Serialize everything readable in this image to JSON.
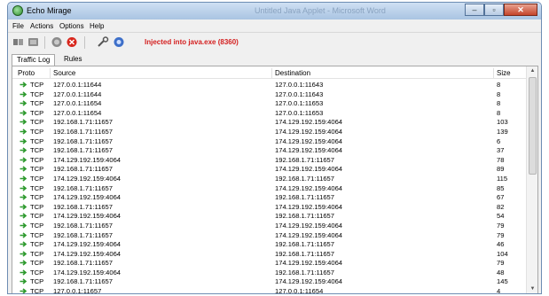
{
  "window": {
    "title": "Echo Mirage",
    "background_title": "Untitled Java Applet - Microsoft Word",
    "controls": [
      "–",
      "▫",
      "✕"
    ]
  },
  "menu": [
    "File",
    "Actions",
    "Options",
    "Help"
  ],
  "toolbar": {
    "status": "Injected into java.exe (8360)"
  },
  "tabs": [
    "Traffic Log",
    "Rules"
  ],
  "table": {
    "columns": [
      "Proto",
      "Source",
      "Destination",
      "Size"
    ],
    "rows": [
      [
        "TCP",
        "127.0.0.1:11644",
        "127.0.0.1:11643",
        "8"
      ],
      [
        "TCP",
        "127.0.0.1:11644",
        "127.0.0.1:11643",
        "8"
      ],
      [
        "TCP",
        "127.0.0.1:11654",
        "127.0.0.1:11653",
        "8"
      ],
      [
        "TCP",
        "127.0.0.1:11654",
        "127.0.0.1:11653",
        "8"
      ],
      [
        "TCP",
        "192.168.1.71:11657",
        "174.129.192.159:4064",
        "103"
      ],
      [
        "TCP",
        "192.168.1.71:11657",
        "174.129.192.159:4064",
        "139"
      ],
      [
        "TCP",
        "192.168.1.71:11657",
        "174.129.192.159:4064",
        "6"
      ],
      [
        "TCP",
        "192.168.1.71:11657",
        "174.129.192.159:4064",
        "37"
      ],
      [
        "TCP",
        "174.129.192.159:4064",
        "192.168.1.71:11657",
        "78"
      ],
      [
        "TCP",
        "192.168.1.71:11657",
        "174.129.192.159:4064",
        "89"
      ],
      [
        "TCP",
        "174.129.192.159:4064",
        "192.168.1.71:11657",
        "115"
      ],
      [
        "TCP",
        "192.168.1.71:11657",
        "174.129.192.159:4064",
        "85"
      ],
      [
        "TCP",
        "174.129.192.159:4064",
        "192.168.1.71:11657",
        "67"
      ],
      [
        "TCP",
        "192.168.1.71:11657",
        "174.129.192.159:4064",
        "82"
      ],
      [
        "TCP",
        "174.129.192.159:4064",
        "192.168.1.71:11657",
        "54"
      ],
      [
        "TCP",
        "192.168.1.71:11657",
        "174.129.192.159:4064",
        "79"
      ],
      [
        "TCP",
        "192.168.1.71:11657",
        "174.129.192.159:4064",
        "79"
      ],
      [
        "TCP",
        "174.129.192.159:4064",
        "192.168.1.71:11657",
        "46"
      ],
      [
        "TCP",
        "174.129.192.159:4064",
        "192.168.1.71:11657",
        "104"
      ],
      [
        "TCP",
        "192.168.1.71:11657",
        "174.129.192.159:4064",
        "79"
      ],
      [
        "TCP",
        "174.129.192.159:4064",
        "192.168.1.71:11657",
        "48"
      ],
      [
        "TCP",
        "192.168.1.71:11657",
        "174.129.192.159:4064",
        "145"
      ],
      [
        "TCP",
        "127.0.0.1:11657",
        "127.0.0.1:11654",
        "4"
      ]
    ]
  },
  "icons": {
    "app": "echo-mirage-icon",
    "row": "green-arrow-icon",
    "toolbar": [
      "stop-icon",
      "record-icon",
      "wrench-icon",
      "inject-icon"
    ]
  },
  "colors": {
    "status_text": "#d42020",
    "row_arrow": "#2e9a2e"
  }
}
